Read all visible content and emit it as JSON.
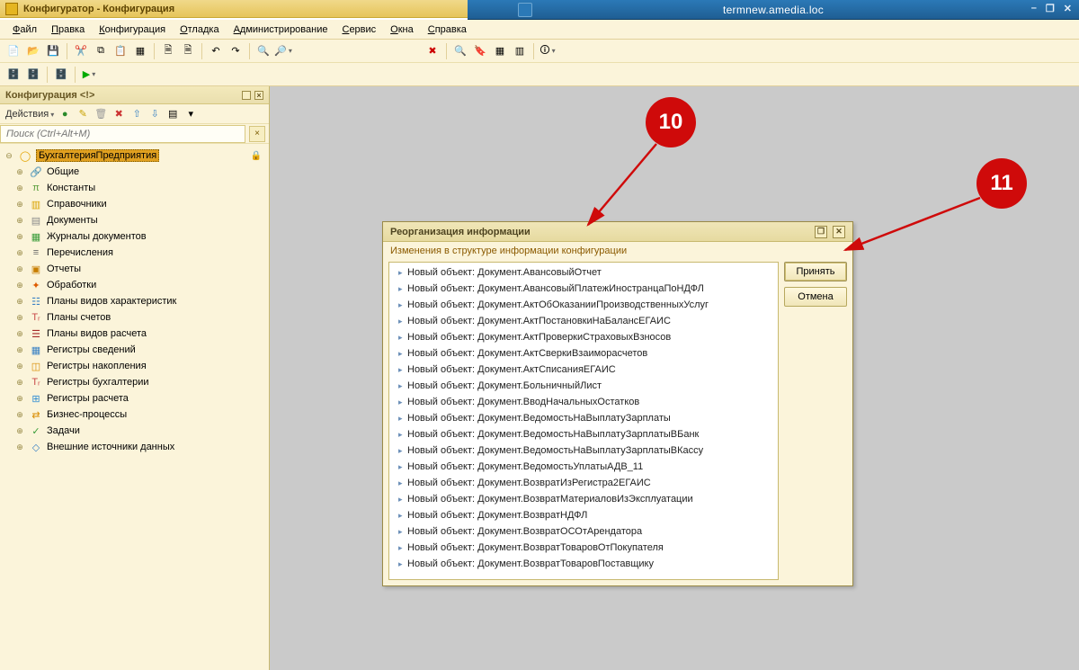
{
  "titlebar": {
    "app": "Конфигуратор - Конфигурация"
  },
  "rdp": {
    "host": "termnew.amedia.loc",
    "min": "–",
    "max": "❐",
    "close": "✕"
  },
  "menu": [
    "Файл",
    "Правка",
    "Конфигурация",
    "Отладка",
    "Администрирование",
    "Сервис",
    "Окна",
    "Справка"
  ],
  "sidebar": {
    "title": "Конфигурация <!>",
    "actions_label": "Действия",
    "search_placeholder": "Поиск (Ctrl+Alt+M)",
    "clear_x": "×",
    "root": {
      "label": "БухгалтерияПредприятия"
    },
    "items": [
      {
        "i": "🔗",
        "c": "#e07000",
        "label": "Общие"
      },
      {
        "i": "π",
        "c": "#5a9e3c",
        "label": "Константы"
      },
      {
        "i": "▥",
        "c": "#d9a300",
        "label": "Справочники"
      },
      {
        "i": "▤",
        "c": "#8a8a8a",
        "label": "Документы"
      },
      {
        "i": "▦",
        "c": "#3a9c3a",
        "label": "Журналы документов"
      },
      {
        "i": "≡",
        "c": "#6a6a6a",
        "label": "Перечисления"
      },
      {
        "i": "▣",
        "c": "#c77d00",
        "label": "Отчеты"
      },
      {
        "i": "✦",
        "c": "#de5b00",
        "label": "Обработки"
      },
      {
        "i": "☷",
        "c": "#3b82c4",
        "label": "Планы видов характеристик"
      },
      {
        "i": "Tᵣ",
        "c": "#c94848",
        "label": "Планы счетов"
      },
      {
        "i": "☰",
        "c": "#a52a2a",
        "label": "Планы видов расчета"
      },
      {
        "i": "▦",
        "c": "#3b82c4",
        "label": "Регистры сведений"
      },
      {
        "i": "◫",
        "c": "#d88b00",
        "label": "Регистры накопления"
      },
      {
        "i": "Tᵣ",
        "c": "#c94848",
        "label": "Регистры бухгалтерии"
      },
      {
        "i": "⊞",
        "c": "#2e8bd4",
        "label": "Регистры расчета"
      },
      {
        "i": "⇄",
        "c": "#d88b00",
        "label": "Бизнес-процессы"
      },
      {
        "i": "✓",
        "c": "#3a9c3a",
        "label": "Задачи"
      },
      {
        "i": "◇",
        "c": "#3b82c4",
        "label": "Внешние источники данных"
      }
    ]
  },
  "dialog": {
    "title": "Реорганизация информации",
    "subtitle": "Изменения в структуре информации конфигурации",
    "accept": "Принять",
    "cancel": "Отмена",
    "max": "❐",
    "close": "✕",
    "rows": [
      "Новый объект: Документ.АвансовыйОтчет",
      "Новый объект: Документ.АвансовыйПлатежИностранцаПоНДФЛ",
      "Новый объект: Документ.АктОбОказанииПроизводственныхУслуг",
      "Новый объект: Документ.АктПостановкиНаБалансЕГАИС",
      "Новый объект: Документ.АктПроверкиСтраховыхВзносов",
      "Новый объект: Документ.АктСверкиВзаиморасчетов",
      "Новый объект: Документ.АктСписанияЕГАИС",
      "Новый объект: Документ.БольничныйЛист",
      "Новый объект: Документ.ВводНачальныхОстатков",
      "Новый объект: Документ.ВедомостьНаВыплатуЗарплаты",
      "Новый объект: Документ.ВедомостьНаВыплатуЗарплатыВБанк",
      "Новый объект: Документ.ВедомостьНаВыплатуЗарплатыВКассу",
      "Новый объект: Документ.ВедомостьУплатыАДВ_11",
      "Новый объект: Документ.ВозвратИзРегистра2ЕГАИС",
      "Новый объект: Документ.ВозвратМатериаловИзЭксплуатации",
      "Новый объект: Документ.ВозвратНДФЛ",
      "Новый объект: Документ.ВозвратОСОтАрендатора",
      "Новый объект: Документ.ВозвратТоваровОтПокупателя",
      "Новый объект: Документ.ВозвратТоваровПоставщику"
    ]
  },
  "badges": {
    "b10": "10",
    "b11": "11"
  }
}
